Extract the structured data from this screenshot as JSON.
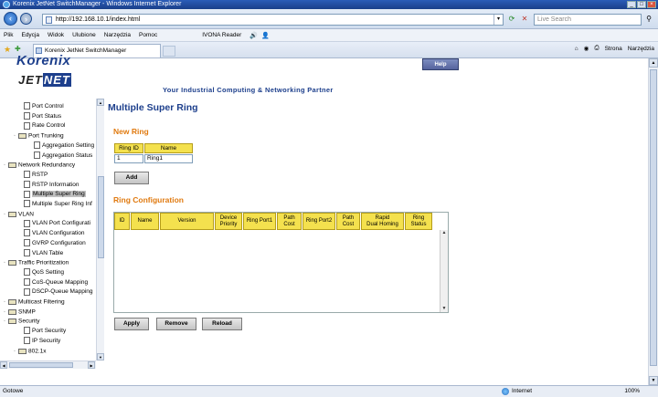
{
  "window": {
    "title": "Korenix JetNet SwitchManager - Windows Internet Explorer",
    "controls": [
      "_",
      "□",
      "×"
    ]
  },
  "address": {
    "url": "http://192.168.10.1/index.html",
    "search_placeholder": "Live Search"
  },
  "menu": {
    "items": [
      "Plik",
      "Edycja",
      "Widok",
      "Ulubione",
      "Narzędzia",
      "Pomoc"
    ],
    "ivona": "IVONA Reader"
  },
  "tabs": {
    "active_tab": "Korenix JetNet SwitchManager",
    "commands": [
      "Strona",
      "Narzędzia"
    ]
  },
  "header": {
    "logo_top": "Korenix",
    "logo_jet": "JET",
    "logo_net": "NET",
    "help_button": "Help",
    "tagline": "Your Industrial Computing & Networking Partner"
  },
  "tree": [
    {
      "label": "Port Control",
      "type": "doc"
    },
    {
      "label": "Port Status",
      "type": "doc"
    },
    {
      "label": "Rate Control",
      "type": "doc"
    },
    {
      "label": "Port Trunking",
      "type": "folder"
    },
    {
      "label": "Aggregation Setting",
      "type": "doc"
    },
    {
      "label": "Aggregation Status",
      "type": "doc"
    },
    {
      "label": "Network Redundancy",
      "type": "folder"
    },
    {
      "label": "RSTP",
      "type": "doc"
    },
    {
      "label": "RSTP Information",
      "type": "doc"
    },
    {
      "label": "Multiple Super Ring",
      "type": "doc",
      "selected": true
    },
    {
      "label": "Multiple Super Ring Inf",
      "type": "doc"
    },
    {
      "label": "VLAN",
      "type": "folder"
    },
    {
      "label": "VLAN Port Configurati",
      "type": "doc"
    },
    {
      "label": "VLAN Configuration",
      "type": "doc"
    },
    {
      "label": "GVRP Configuration",
      "type": "doc"
    },
    {
      "label": "VLAN Table",
      "type": "doc"
    },
    {
      "label": "Traffic Prioritization",
      "type": "folder"
    },
    {
      "label": "QoS Setting",
      "type": "doc"
    },
    {
      "label": "CoS-Queue Mapping",
      "type": "doc"
    },
    {
      "label": "DSCP-Queue Mapping",
      "type": "doc"
    },
    {
      "label": "Multicast Filtering",
      "type": "folder"
    },
    {
      "label": "SNMP",
      "type": "folder"
    },
    {
      "label": "Security",
      "type": "folder"
    },
    {
      "label": "Port Security",
      "type": "doc"
    },
    {
      "label": "IP Security",
      "type": "doc"
    },
    {
      "label": "802.1x",
      "type": "folder"
    }
  ],
  "main": {
    "page_title": "Multiple Super Ring",
    "new_ring": {
      "title": "New Ring",
      "col_id": "Ring ID",
      "col_name": "Name",
      "id_value": "1",
      "name_value": "Ring1",
      "add_button": "Add"
    },
    "ring_config": {
      "title": "Ring Configuration",
      "columns": [
        "ID",
        "Name",
        "Version",
        "Device\nPriority",
        "Ring Port1",
        "Path\nCost",
        "Ring Port2",
        "Path\nCost",
        "Rapid\nDual Homing",
        "Ring\nStatus"
      ],
      "rows": []
    },
    "buttons": {
      "apply": "Apply",
      "remove": "Remove",
      "reload": "Reload"
    }
  },
  "status": {
    "left": "Gotowe",
    "zone": "Internet",
    "zoom": "100%"
  }
}
